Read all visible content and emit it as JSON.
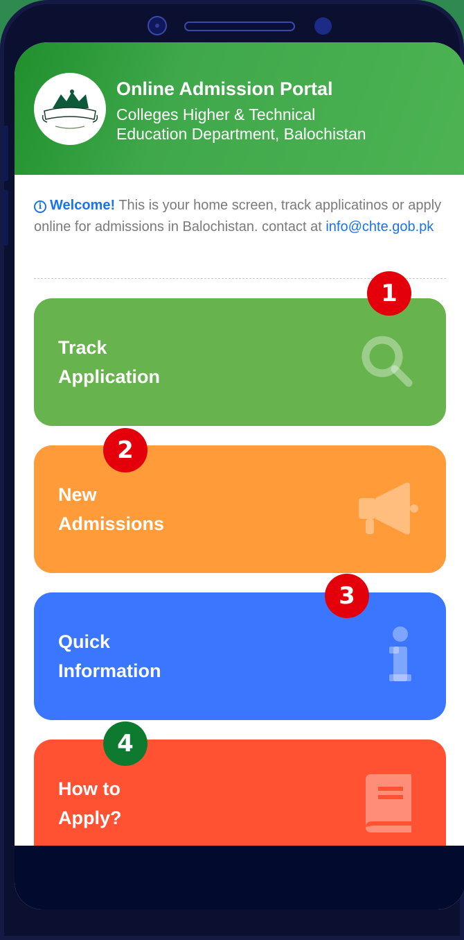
{
  "header": {
    "title": "Online Admission Portal",
    "subtitle_line1": "Colleges Higher & Technical",
    "subtitle_line2": "Education Department, Balochistan"
  },
  "welcome": {
    "heading": "Welcome!",
    "text": "This is your home screen, track applicatinos or apply online for admissions in Balochistan. contact at",
    "email": "info@chte.gob.pk"
  },
  "cards": [
    {
      "line1": "Track",
      "line2": "Application",
      "icon": "search-icon",
      "color": "#67b34e"
    },
    {
      "line1": "New",
      "line2": "Admissions",
      "icon": "megaphone-icon",
      "color": "#ff9b39"
    },
    {
      "line1": "Quick",
      "line2": "Information",
      "icon": "info-icon",
      "color": "#3a76ff"
    },
    {
      "line1": "How to",
      "line2": "Apply?",
      "icon": "book-icon",
      "color": "#ff5232"
    }
  ],
  "badges": [
    "1",
    "2",
    "3",
    "4"
  ],
  "colors": {
    "header_green": "#3fa84a",
    "link_blue": "#1a73e8",
    "badge_red": "#e4000a",
    "badge_green": "#0d7a30"
  }
}
